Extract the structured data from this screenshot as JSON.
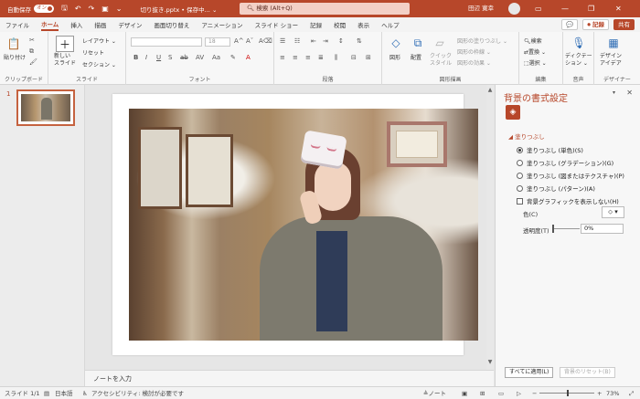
{
  "titlebar": {
    "autosave_label": "自動保存",
    "autosave_state": "オン",
    "filename": "切り抜き.pptx • 保存中... ⌄",
    "search_placeholder": "検索 (Alt+Q)",
    "user_name": "田辺 寛幸",
    "minimize": "—",
    "restore": "❐",
    "close": "✕"
  },
  "tabs": [
    "ファイル",
    "ホーム",
    "挿入",
    "描画",
    "デザイン",
    "画面切り替え",
    "アニメーション",
    "スライド ショー",
    "記録",
    "校閲",
    "表示",
    "ヘルプ"
  ],
  "tabs_right": {
    "comment": "💬",
    "record": "⏺ 記録",
    "share": "共有"
  },
  "ribbon": {
    "clipboard": {
      "label": "クリップボード",
      "paste": "貼り付け"
    },
    "slides": {
      "label": "スライド",
      "new_slide": "新しい\nスライド",
      "layout": "レイアウト ⌄",
      "reset": "リセット",
      "section": "セクション ⌄"
    },
    "font": {
      "label": "フォント",
      "size": "18"
    },
    "paragraph": {
      "label": "段落"
    },
    "drawing": {
      "label": "図形描画",
      "shape": "図形",
      "arrange": "配置",
      "quick_styles": "クイック\nスタイル",
      "fill": "図形の塗りつぶし ⌄",
      "outline": "図形の枠線 ⌄",
      "effects": "図形の効果 ⌄"
    },
    "editing": {
      "label": "編集",
      "find": "検索",
      "replace": "置換 ⌄",
      "select": "選択 ⌄"
    },
    "voice": {
      "label": "音声",
      "dictate": "ディクテー\nション ⌄"
    },
    "designer": {
      "label": "デザイナー",
      "ideas": "デザイン\nアイデア"
    }
  },
  "thumbnails": {
    "slide_number": "1"
  },
  "notes": {
    "placeholder": "ノートを入力"
  },
  "format_pane": {
    "title": "背景の書式設定",
    "section_fill": "◢ 塗りつぶし",
    "options": [
      {
        "label": "塗りつぶし (単色)(S)",
        "selected": true
      },
      {
        "label": "塗りつぶし (グラデーション)(G)",
        "selected": false
      },
      {
        "label": "塗りつぶし (図またはテクスチャ)(P)",
        "selected": false
      },
      {
        "label": "塗りつぶし (パターン)(A)",
        "selected": false
      }
    ],
    "hide_bg_graphics": "背景グラフィックを表示しない(H)",
    "color_label": "色(C)",
    "transparency_label": "透明度(T)",
    "transparency_value": "0%",
    "apply_all": "すべてに適用(L)",
    "reset_bg": "背景のリセット(B)"
  },
  "statusbar": {
    "slide_info": "スライド 1/1",
    "language": "日本語",
    "accessibility": "アクセシビリティ: 検討が必要です",
    "notes": "≜ノート",
    "zoom": "73%"
  },
  "colors": {
    "accent": "#b7472a"
  }
}
